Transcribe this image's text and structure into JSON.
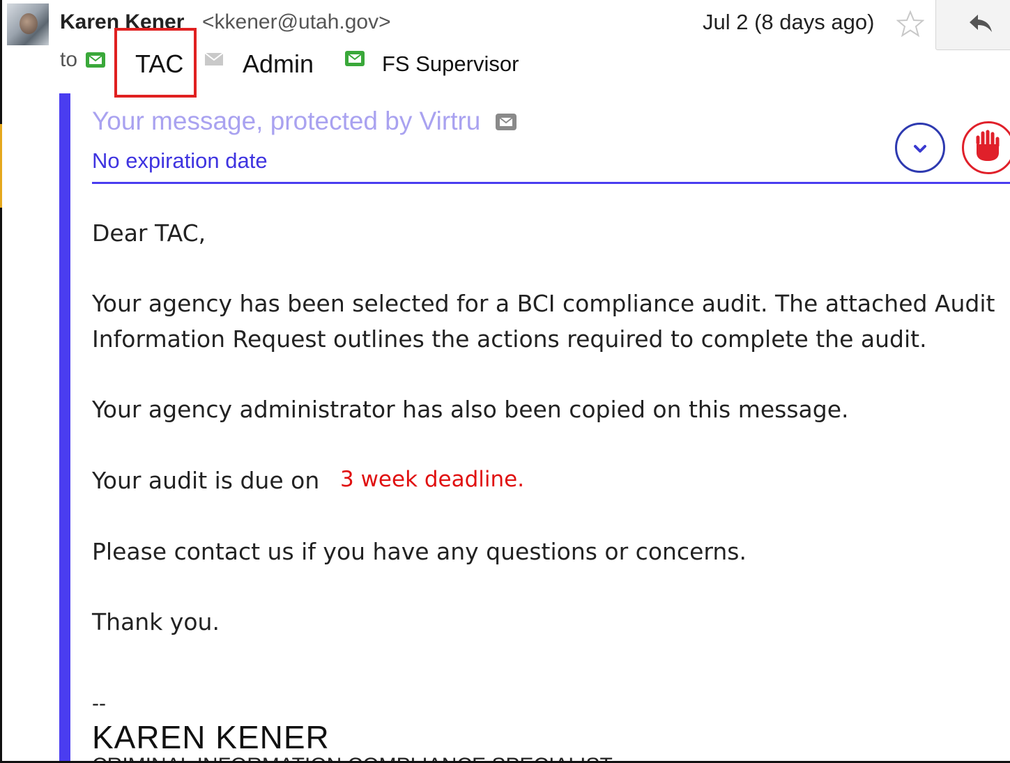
{
  "header": {
    "sender_name": "Karen Kener",
    "sender_email": "<kkener@utah.gov>",
    "date": "Jul 2 (8 days ago)",
    "to_label": "to",
    "recipients": [
      "TAC",
      "Admin",
      "FS Supervisor"
    ]
  },
  "virtru": {
    "title": "Your message, protected by Virtru",
    "expiry": "No expiration date"
  },
  "message": {
    "greeting": "Dear TAC,",
    "para1_line1": "Your agency has been selected for a BCI compliance audit. The attached Audit",
    "para1_line2": "Information Request outlines the actions required to complete the audit.",
    "para2": "Your agency administrator has also been copied on this message.",
    "due_prefix": "Your audit is due on",
    "due_note": "3 week deadline.",
    "para4": "Please contact us if you have any questions or concerns.",
    "closing": "Thank you."
  },
  "signature": {
    "dash": "--",
    "name": "KAREN KENER",
    "title": "CRIMINAL INFORMATION COMPLIANCE SPECIALIST"
  },
  "colors": {
    "virtru_bar": "#4a3df0",
    "highlight_box": "#e02020",
    "deadline_text": "#e01010",
    "envelope_green": "#3aa83a"
  },
  "icons": [
    "star-icon",
    "reply-icon",
    "secure-envelope-icon",
    "plain-envelope-icon",
    "chevron-down-icon",
    "hand-stop-icon"
  ]
}
